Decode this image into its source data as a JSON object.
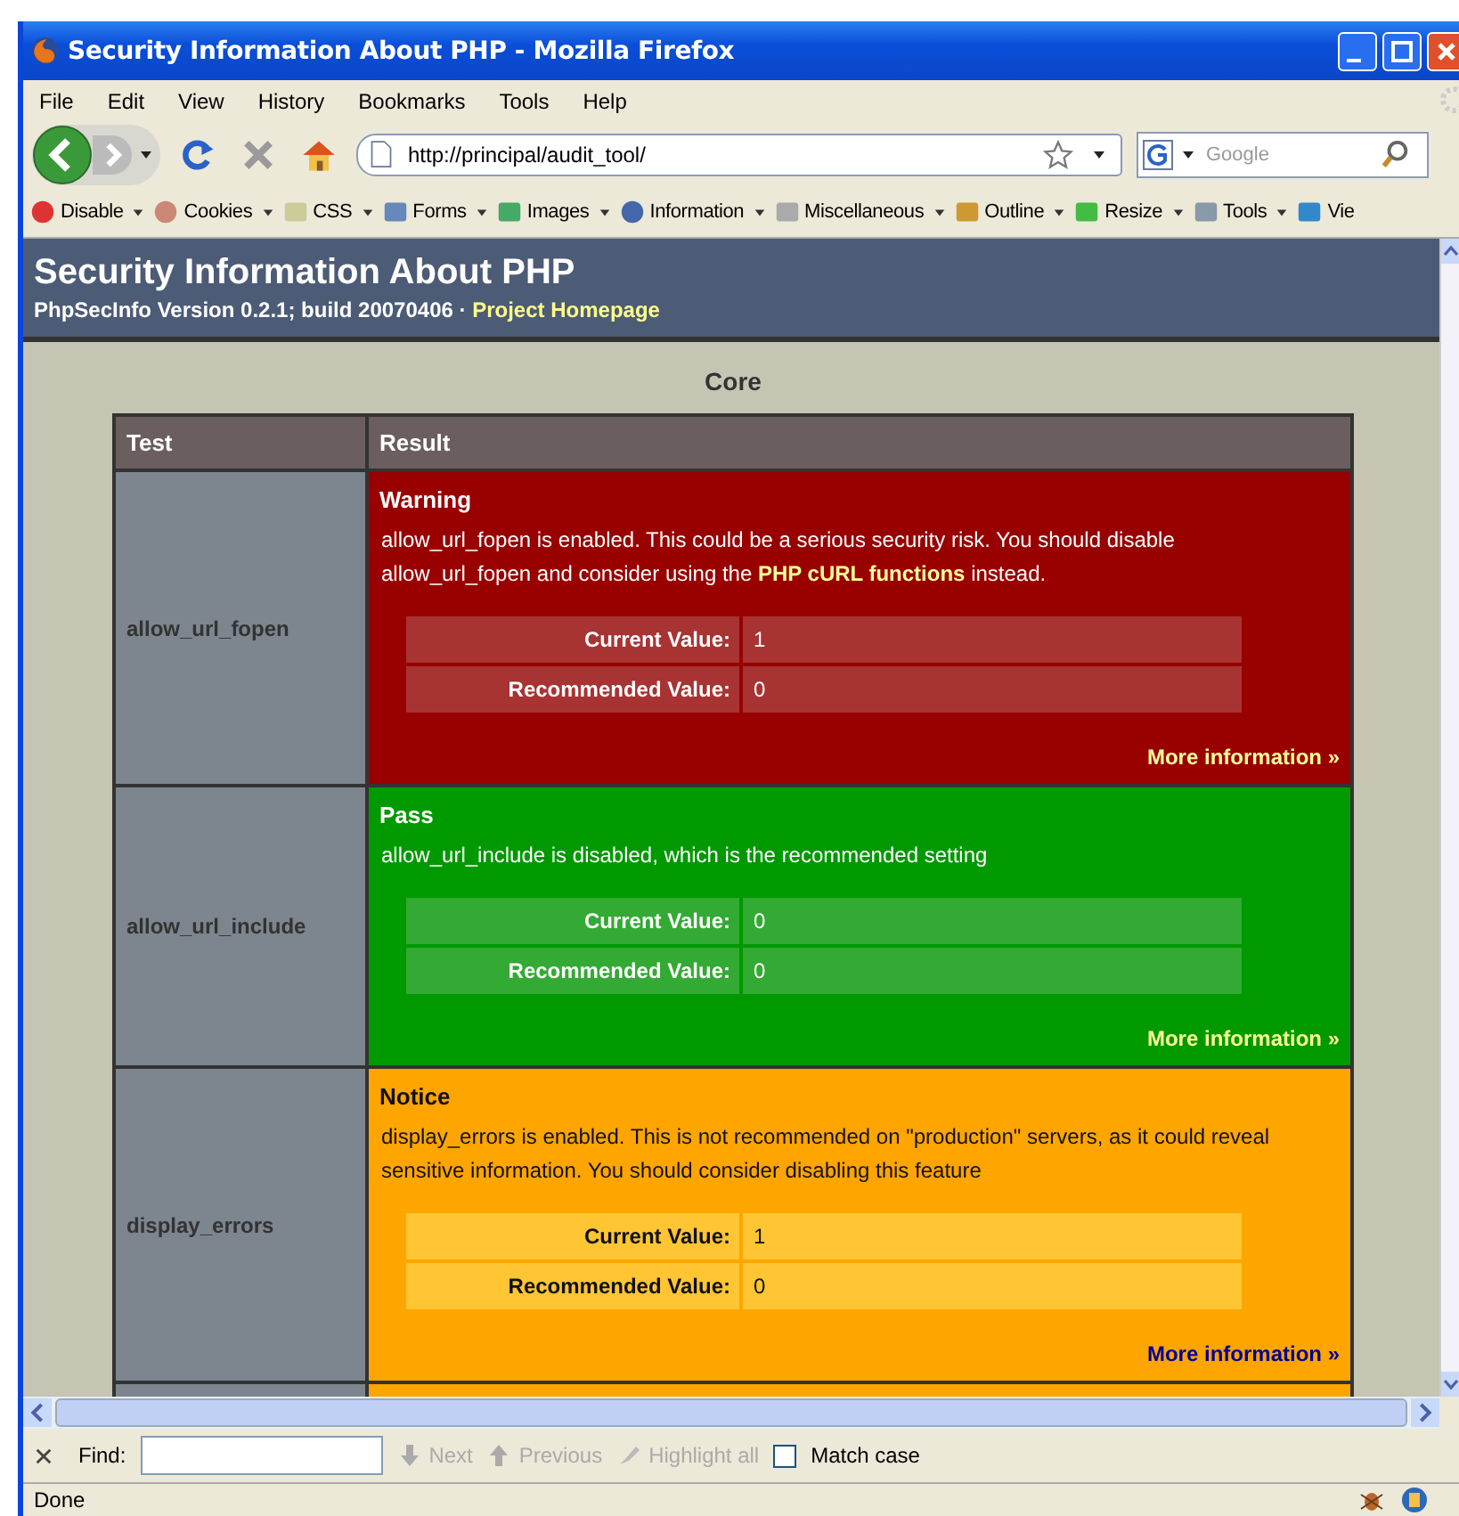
{
  "window": {
    "title": "Security Information About PHP - Mozilla Firefox"
  },
  "menu": [
    "File",
    "Edit",
    "View",
    "History",
    "Bookmarks",
    "Tools",
    "Help"
  ],
  "navigation": {
    "url": "http://principal/audit_tool/",
    "search_placeholder": "Google"
  },
  "toolbar": [
    {
      "kind": "disable",
      "label": "Disable"
    },
    {
      "kind": "cookies",
      "label": "Cookies"
    },
    {
      "kind": "css",
      "label": "CSS"
    },
    {
      "kind": "forms",
      "label": "Forms"
    },
    {
      "kind": "images",
      "label": "Images"
    },
    {
      "kind": "information",
      "label": "Information"
    },
    {
      "kind": "miscellaneous",
      "label": "Miscellaneous"
    },
    {
      "kind": "outline",
      "label": "Outline"
    },
    {
      "kind": "resize",
      "label": "Resize"
    },
    {
      "kind": "tools",
      "label": "Tools"
    },
    {
      "kind": "view",
      "label": "Vie"
    }
  ],
  "page": {
    "title": "Security Information About PHP",
    "subtitle": "PhpSecInfo Version 0.2.1; build 20070406 · ",
    "homepage_link": "Project Homepage",
    "section": "Core",
    "table": {
      "columns": [
        "Test",
        "Result"
      ],
      "rows": [
        {
          "test": "allow_url_fopen",
          "kind": "warning",
          "status": "Warning",
          "description": [
            {
              "kind": "text",
              "text": "allow_url_fopen is enabled. This could be a serious security risk. You should disable allow_url_fopen and consider using the "
            },
            {
              "kind": "link",
              "text": "PHP cURL functions"
            },
            {
              "kind": "text",
              "text": " instead."
            }
          ],
          "values": [
            {
              "label": "Current Value:",
              "value": "1"
            },
            {
              "label": "Recommended Value:",
              "value": "0"
            }
          ],
          "more": "More information »"
        },
        {
          "test": "allow_url_include",
          "kind": "pass",
          "status": "Pass",
          "description": [
            {
              "kind": "text",
              "text": "allow_url_include is disabled, which is the recommended setting"
            }
          ],
          "values": [
            {
              "label": "Current Value:",
              "value": "0"
            },
            {
              "label": "Recommended Value:",
              "value": "0"
            }
          ],
          "more": "More information »"
        },
        {
          "test": "display_errors",
          "kind": "notice",
          "status": "Notice",
          "description": [
            {
              "kind": "text",
              "text": "display_errors is enabled. This is not recommended on \"production\" servers, as it could reveal sensitive information. You should consider disabling this feature"
            }
          ],
          "values": [
            {
              "label": "Current Value:",
              "value": "1"
            },
            {
              "label": "Recommended Value:",
              "value": "0"
            }
          ],
          "more": "More information »"
        },
        {
          "kind": "notice"
        }
      ]
    }
  },
  "find_bar": {
    "label": "Find:",
    "next": "Next",
    "previous": "Previous",
    "highlight": "Highlight all",
    "match_case": {
      "label": "Match case",
      "checked": false
    }
  },
  "status_bar": {
    "text": "Done"
  }
}
